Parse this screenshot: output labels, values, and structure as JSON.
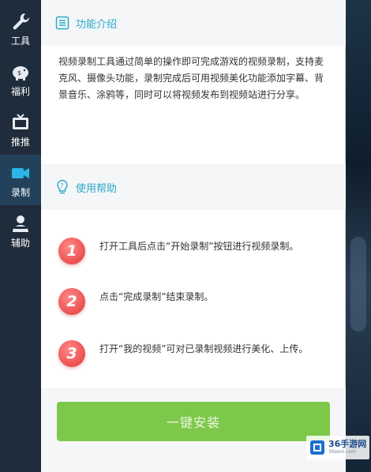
{
  "sidebar": {
    "items": [
      {
        "label": "工具",
        "icon": "wrench-icon"
      },
      {
        "label": "福利",
        "icon": "piggy-bank-icon"
      },
      {
        "label": "推推",
        "icon": "tv-icon"
      },
      {
        "label": "录制",
        "icon": "video-camera-icon"
      },
      {
        "label": "辅助",
        "icon": "helper-icon"
      }
    ],
    "active_index": 3
  },
  "intro": {
    "title": "功能介绍",
    "text": "视频录制工具通过简单的操作即可完成游戏的视频录制，支持麦克风、摄像头功能，录制完成后可用视频美化功能添加字幕、背景音乐、涂鸦等，同时可以将视频发布到视频站进行分享。"
  },
  "help": {
    "title": "使用帮助",
    "steps": [
      {
        "num": "1",
        "text": "打开工具后点击“开始录制”按钮进行视频录制。"
      },
      {
        "num": "2",
        "text": "点击“完成录制”结束录制。"
      },
      {
        "num": "3",
        "text": "打开“我的视频”可对已录制视频进行美化、上传。"
      }
    ]
  },
  "install_button": {
    "label": "一键安装"
  },
  "watermark": {
    "main": "36手游网",
    "sub": "36sem.com"
  },
  "colors": {
    "accent": "#2aa9c9",
    "button": "#7dc84a",
    "badge": "#f15b5b",
    "sidebar": "#1f2c3b"
  }
}
